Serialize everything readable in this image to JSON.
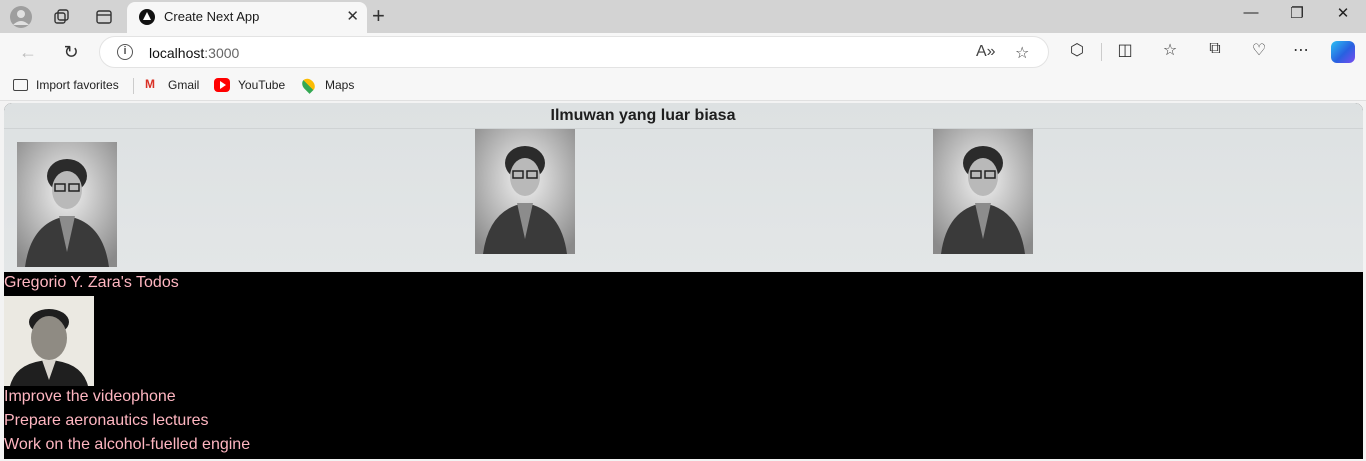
{
  "browser": {
    "tab_title": "Create Next App",
    "url_host": "localhost",
    "url_port": ":3000",
    "bookmarks": [
      "Import favorites",
      "Gmail",
      "YouTube",
      "Maps"
    ]
  },
  "page": {
    "gallery_title": "Ilmuwan yang luar biasa",
    "todo_title": "Gregorio Y. Zara's Todos",
    "todos": [
      "Improve the videophone",
      "Prepare aeronautics lectures",
      "Work on the alcohol-fuelled engine"
    ]
  }
}
